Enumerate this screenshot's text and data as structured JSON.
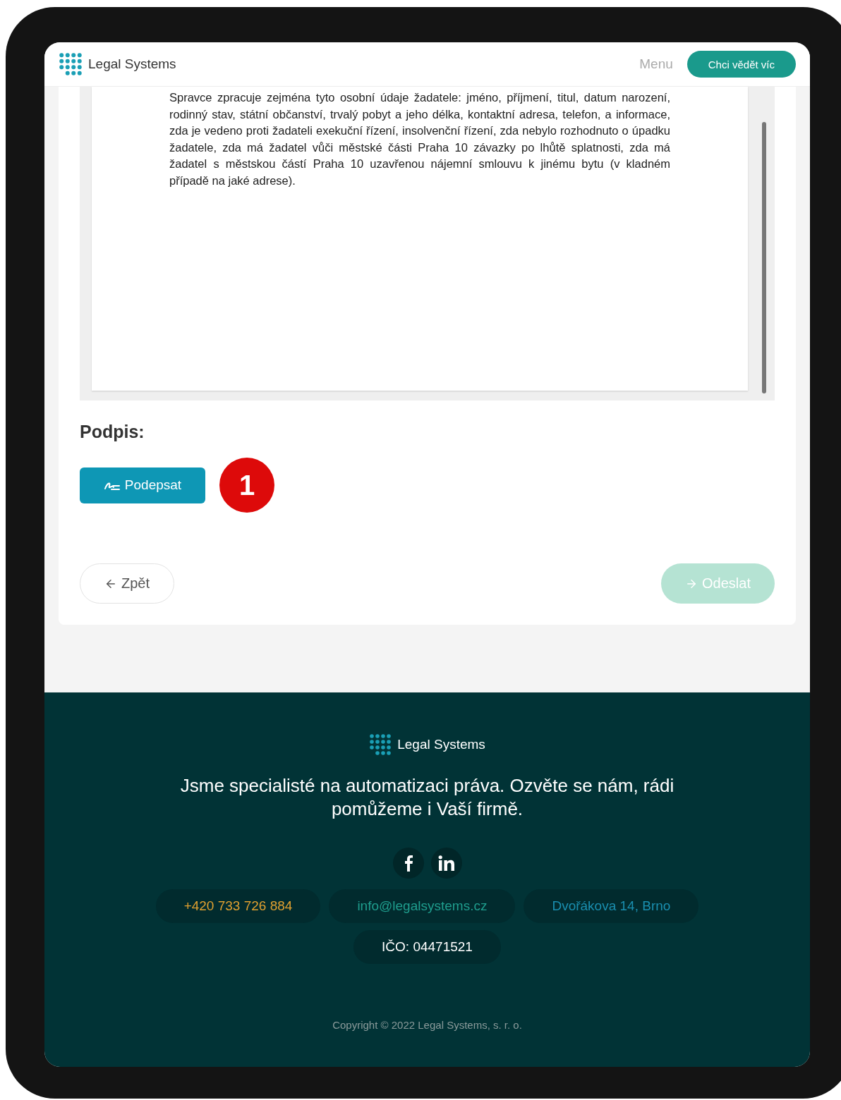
{
  "header": {
    "brand": "Legal Systems",
    "menu": "Menu",
    "cta": "Chci vědět víc"
  },
  "document": {
    "text": "Spravce zpracuje zejména tyto osobní údaje žadatele: jméno, příjmení, titul, datum narození, rodinný stav, státní občanství, trvalý pobyt a jeho délka, kontaktní adresa, telefon, a informace, zda je vedeno proti žadateli exekuční řízení, insolvenční řízení, zda nebylo rozhodnuto o úpadku žadatele, zda má žadatel vůči městské části Praha 10 závazky po lhůtě splatnosti, zda má žadatel s městskou částí Praha 10 uzavřenou nájemní smlouvu k jinému bytu (v kladném případě na jaké adrese)."
  },
  "signature": {
    "title": "Podpis:",
    "button": "Podepsat",
    "marker": "1"
  },
  "nav": {
    "back": {
      "label": "Zpět",
      "disabled": false
    },
    "submit": {
      "label": "Odeslat",
      "disabled": true
    }
  },
  "footer": {
    "brand": "Legal Systems",
    "tagline": "Jsme specialisté na automatizaci práva. Ozvěte se nám, rádi pomůžeme i Vaší firmě.",
    "social": [
      {
        "kind": "facebook"
      },
      {
        "kind": "linkedin"
      }
    ],
    "contacts": [
      {
        "text": "+420 733 726 884",
        "color": "#e0a030"
      },
      {
        "text": "info@legalsystems.cz",
        "color": "#1f9e8e"
      },
      {
        "text": "Dvořákova 14, Brno",
        "color": "#1a8fb0"
      }
    ],
    "ico": "IČO: 04471521",
    "copyright": "Copyright © 2022 Legal Systems, s. r. o."
  }
}
